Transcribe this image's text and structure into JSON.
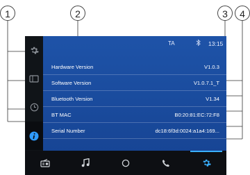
{
  "callouts": [
    "1",
    "2",
    "3",
    "4"
  ],
  "status": {
    "ta": "TA",
    "time": "13:15",
    "bluetooth_icon": "bluetooth-icon"
  },
  "sidebar": {
    "items": [
      {
        "name": "settings",
        "icon": "gear-icon"
      },
      {
        "name": "display",
        "icon": "display-icon"
      },
      {
        "name": "clock",
        "icon": "clock-icon"
      },
      {
        "name": "info",
        "icon": "info-icon",
        "active": true
      }
    ]
  },
  "info_rows": [
    {
      "label": "Hardware Version",
      "value": "V1.0.3"
    },
    {
      "label": "Software Version",
      "value": "V1.0.7.1_T"
    },
    {
      "label": "Bluetooth Version",
      "value": "V1.34"
    },
    {
      "label": "BT MAC",
      "value": "B0:20:81:EC:72:F8"
    },
    {
      "label": "Serial Number",
      "value": "dc18:6f3d:0024:a1a4:169..."
    }
  ],
  "bottom_tabs": [
    {
      "name": "radio",
      "icon": "radio-icon"
    },
    {
      "name": "music",
      "icon": "music-icon"
    },
    {
      "name": "home",
      "icon": "home-icon"
    },
    {
      "name": "phone",
      "icon": "phone-icon"
    },
    {
      "name": "settings",
      "icon": "gear-icon",
      "active": true
    }
  ],
  "colors": {
    "panel": "#1e53a8",
    "sidebar": "#101418",
    "bottom_bar": "#0d0f13",
    "accent": "#3ab0ff"
  }
}
